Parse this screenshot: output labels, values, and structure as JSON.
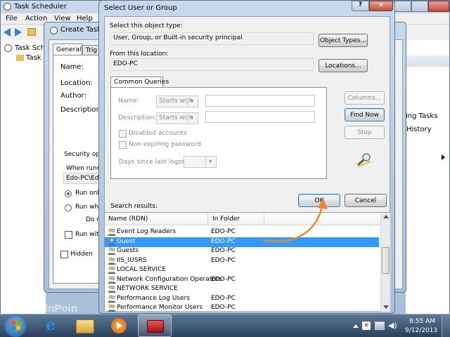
{
  "bg_window": {
    "title": "Task Scheduler",
    "menu": [
      "File",
      "Action",
      "View",
      "Help"
    ],
    "tree": [
      "Task Schedu",
      "Task Sche"
    ],
    "right_items": [
      "ing Tasks",
      "History"
    ]
  },
  "create_task": {
    "title": "Create Task",
    "tabs": [
      "General",
      "Trig"
    ],
    "labels": {
      "name": "Name:",
      "location": "Location:",
      "author": "Author:",
      "description": "Description:"
    },
    "security_title": "Security opt",
    "when_running": "When runn",
    "user_value": "Edo-PC\\Ed",
    "run_only": "Run onl",
    "run_whether": "Run whe",
    "do_not": "Do r",
    "run_with": "Run wit",
    "hidden": "Hidden"
  },
  "dialog": {
    "title": "Select User or Group",
    "object_type_label": "Select this object type:",
    "object_type_value": "User, Group, or Built-in security principal",
    "object_types_button": "Object Types...",
    "location_label": "From this location:",
    "location_value": "EDO-PC",
    "locations_button": "Locations...",
    "tab_label": "Common Queries",
    "name_label": "Name:",
    "name_combo": "Starts with",
    "description_label": "Description:",
    "description_combo": "Starts with",
    "disabled_accounts": "Disabled accounts",
    "non_expiring": "Non expiring password",
    "days_since": "Days since last logon:",
    "columns_button": "Columns...",
    "find_now_button": "Find Now",
    "stop_button": "Stop",
    "ok_button": "OK",
    "cancel_button": "Cancel",
    "search_results_label": "Search results:",
    "col_name": "Name (RDN)",
    "col_folder": "In Folder",
    "results": [
      {
        "name": "Event Log Readers",
        "folder": "EDO-PC",
        "icon": "group-icon"
      },
      {
        "name": "Guest",
        "folder": "EDO-PC",
        "icon": "user-icon",
        "selected": true
      },
      {
        "name": "Guests",
        "folder": "EDO-PC",
        "icon": "group-icon"
      },
      {
        "name": "IIS_IUSRS",
        "folder": "EDO-PC",
        "icon": "group-icon"
      },
      {
        "name": "LOCAL SERVICE",
        "folder": "",
        "icon": "group-icon"
      },
      {
        "name": "Network Configuration Operators",
        "folder": "EDO-PC",
        "icon": "group-icon"
      },
      {
        "name": "NETWORK SERVICE",
        "folder": "",
        "icon": "group-icon"
      },
      {
        "name": "Performance Log Users",
        "folder": "EDO-PC",
        "icon": "group-icon"
      },
      {
        "name": "Performance Monitor Users",
        "folder": "EDO-PC",
        "icon": "group-icon"
      }
    ]
  },
  "taskbar": {
    "time": "8:55 AM",
    "date": "9/12/2013",
    "watermark": "WinPoin",
    "icons": [
      "windows-start-icon",
      "internet-explorer-icon",
      "folder-icon",
      "media-player-icon",
      "toolbox-icon"
    ]
  },
  "colors": {
    "selection": "#3399ff",
    "arrow": "#e8892a",
    "accent": "#3c7fb1"
  }
}
